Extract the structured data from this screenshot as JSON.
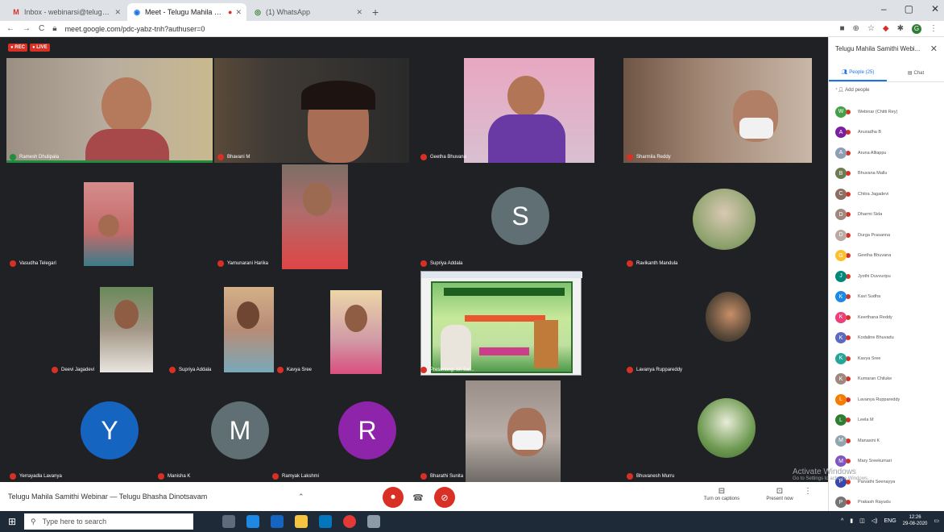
{
  "browser": {
    "tabs": [
      {
        "favicon": "M",
        "title": "Inbox - webinarsi@telugmail.com",
        "active": false,
        "fav_color": "#d93025"
      },
      {
        "favicon": "◉",
        "title": "Meet - Telugu Mahila Samithi",
        "active": true,
        "fav_color": "#1a73e8"
      },
      {
        "favicon": "◎",
        "title": "(1) WhatsApp",
        "active": false,
        "fav_color": "#2e7d32"
      }
    ],
    "new_tab": "+",
    "window_controls": [
      "–",
      "▢",
      "✕"
    ],
    "url": "meet.google.com/pdc-yabz-tnh?authuser=0",
    "profile_initial": "G"
  },
  "meeting": {
    "badges": [
      "● REC",
      "● LIVE"
    ],
    "title": "Telugu Mahila Samithi Webinar — Telugu Bhasha Dinotsavam",
    "activate_windows": "Activate Windows",
    "activate_sub": "Go to Settings to activate Windows.",
    "tiles": [
      {
        "name": "Ramesh Dhulipala"
      },
      {
        "name": "Bhavani M"
      },
      {
        "name": "Geetha Bhuvana"
      },
      {
        "name": "Sharmila Reddy"
      },
      {
        "name": "Vasudha Telegari"
      },
      {
        "name": "Yamunarani Harika"
      },
      {
        "name": "Supriya Addala",
        "initial": "S"
      },
      {
        "name": "Ravikanth Mandula"
      },
      {
        "name": "Deevi Jagadevi"
      },
      {
        "name": "Supriya Addala"
      },
      {
        "name": "Kavya Sree"
      },
      {
        "name": "Presenting: Sri Sai..."
      },
      {
        "name": "Lavanya Ruppareddy"
      },
      {
        "name": "Yerrayadla Lavanya",
        "initial": "Y"
      },
      {
        "name": "Manisha K",
        "initial": "M"
      },
      {
        "name": "Ramyak Lakshmi",
        "initial": "R"
      },
      {
        "name": "Bharathi Sunita"
      },
      {
        "name": "Bhuvanesh Murru"
      }
    ],
    "tools": [
      {
        "icon": "⊟",
        "label": "Turn on captions"
      },
      {
        "icon": "⊡",
        "label": "Present now"
      },
      {
        "icon": "⋮",
        "label": ""
      }
    ]
  },
  "panel": {
    "title": "Telugu Mahila Samithi Webi...",
    "close": "✕",
    "tab_people": "People (25)",
    "tab_chat": "Chat",
    "add_people": "Add people",
    "people": [
      {
        "name": "Webinar (Chitti Rey)",
        "initial": "W",
        "color": "#43a047"
      },
      {
        "name": "Anuradha B",
        "initial": "A",
        "color": "#7b1fa2"
      },
      {
        "name": "Aruna Alliappu",
        "initial": "A",
        "color": "#8e9eb5"
      },
      {
        "name": "Bhuvana Mallu",
        "initial": "B",
        "color": "#6d7c52"
      },
      {
        "name": "Chitra Jagadevi",
        "initial": "C",
        "color": "#8d6e63"
      },
      {
        "name": "Dharmi Sida",
        "initial": "D",
        "color": "#a1887f"
      },
      {
        "name": "Durga Prasanna",
        "initial": "D",
        "color": "#bcaaa4"
      },
      {
        "name": "Geetha Bhuvana",
        "initial": "G",
        "color": "#fbc02d"
      },
      {
        "name": "Jyothi Duvvuripu",
        "initial": "J",
        "color": "#00897b"
      },
      {
        "name": "Kavi Sudha",
        "initial": "K",
        "color": "#1e88e5"
      },
      {
        "name": "Keerthana Reddy",
        "initial": "K",
        "color": "#ec407a"
      },
      {
        "name": "Kodaline Bhuvadu",
        "initial": "K",
        "color": "#5c6bc0"
      },
      {
        "name": "Kavya Sree",
        "initial": "K",
        "color": "#26a69a"
      },
      {
        "name": "Kumaran Chiluke",
        "initial": "K",
        "color": "#a1887f"
      },
      {
        "name": "Lavanya Ruppareddy",
        "initial": "L",
        "color": "#f57c00"
      },
      {
        "name": "Leela M",
        "initial": "L",
        "color": "#2e7d32"
      },
      {
        "name": "Manasini K",
        "initial": "M",
        "color": "#90a4ae"
      },
      {
        "name": "Mary Sreekumari",
        "initial": "M",
        "color": "#7e57c2"
      },
      {
        "name": "Parvathi Seenayya",
        "initial": "P",
        "color": "#3949ab"
      },
      {
        "name": "Prakash Rayudu",
        "initial": "P",
        "color": "#757575"
      }
    ]
  },
  "taskbar": {
    "search_placeholder": "Type here to search",
    "lang": "ENG",
    "time": "12:26",
    "date": "29-08-2020"
  }
}
